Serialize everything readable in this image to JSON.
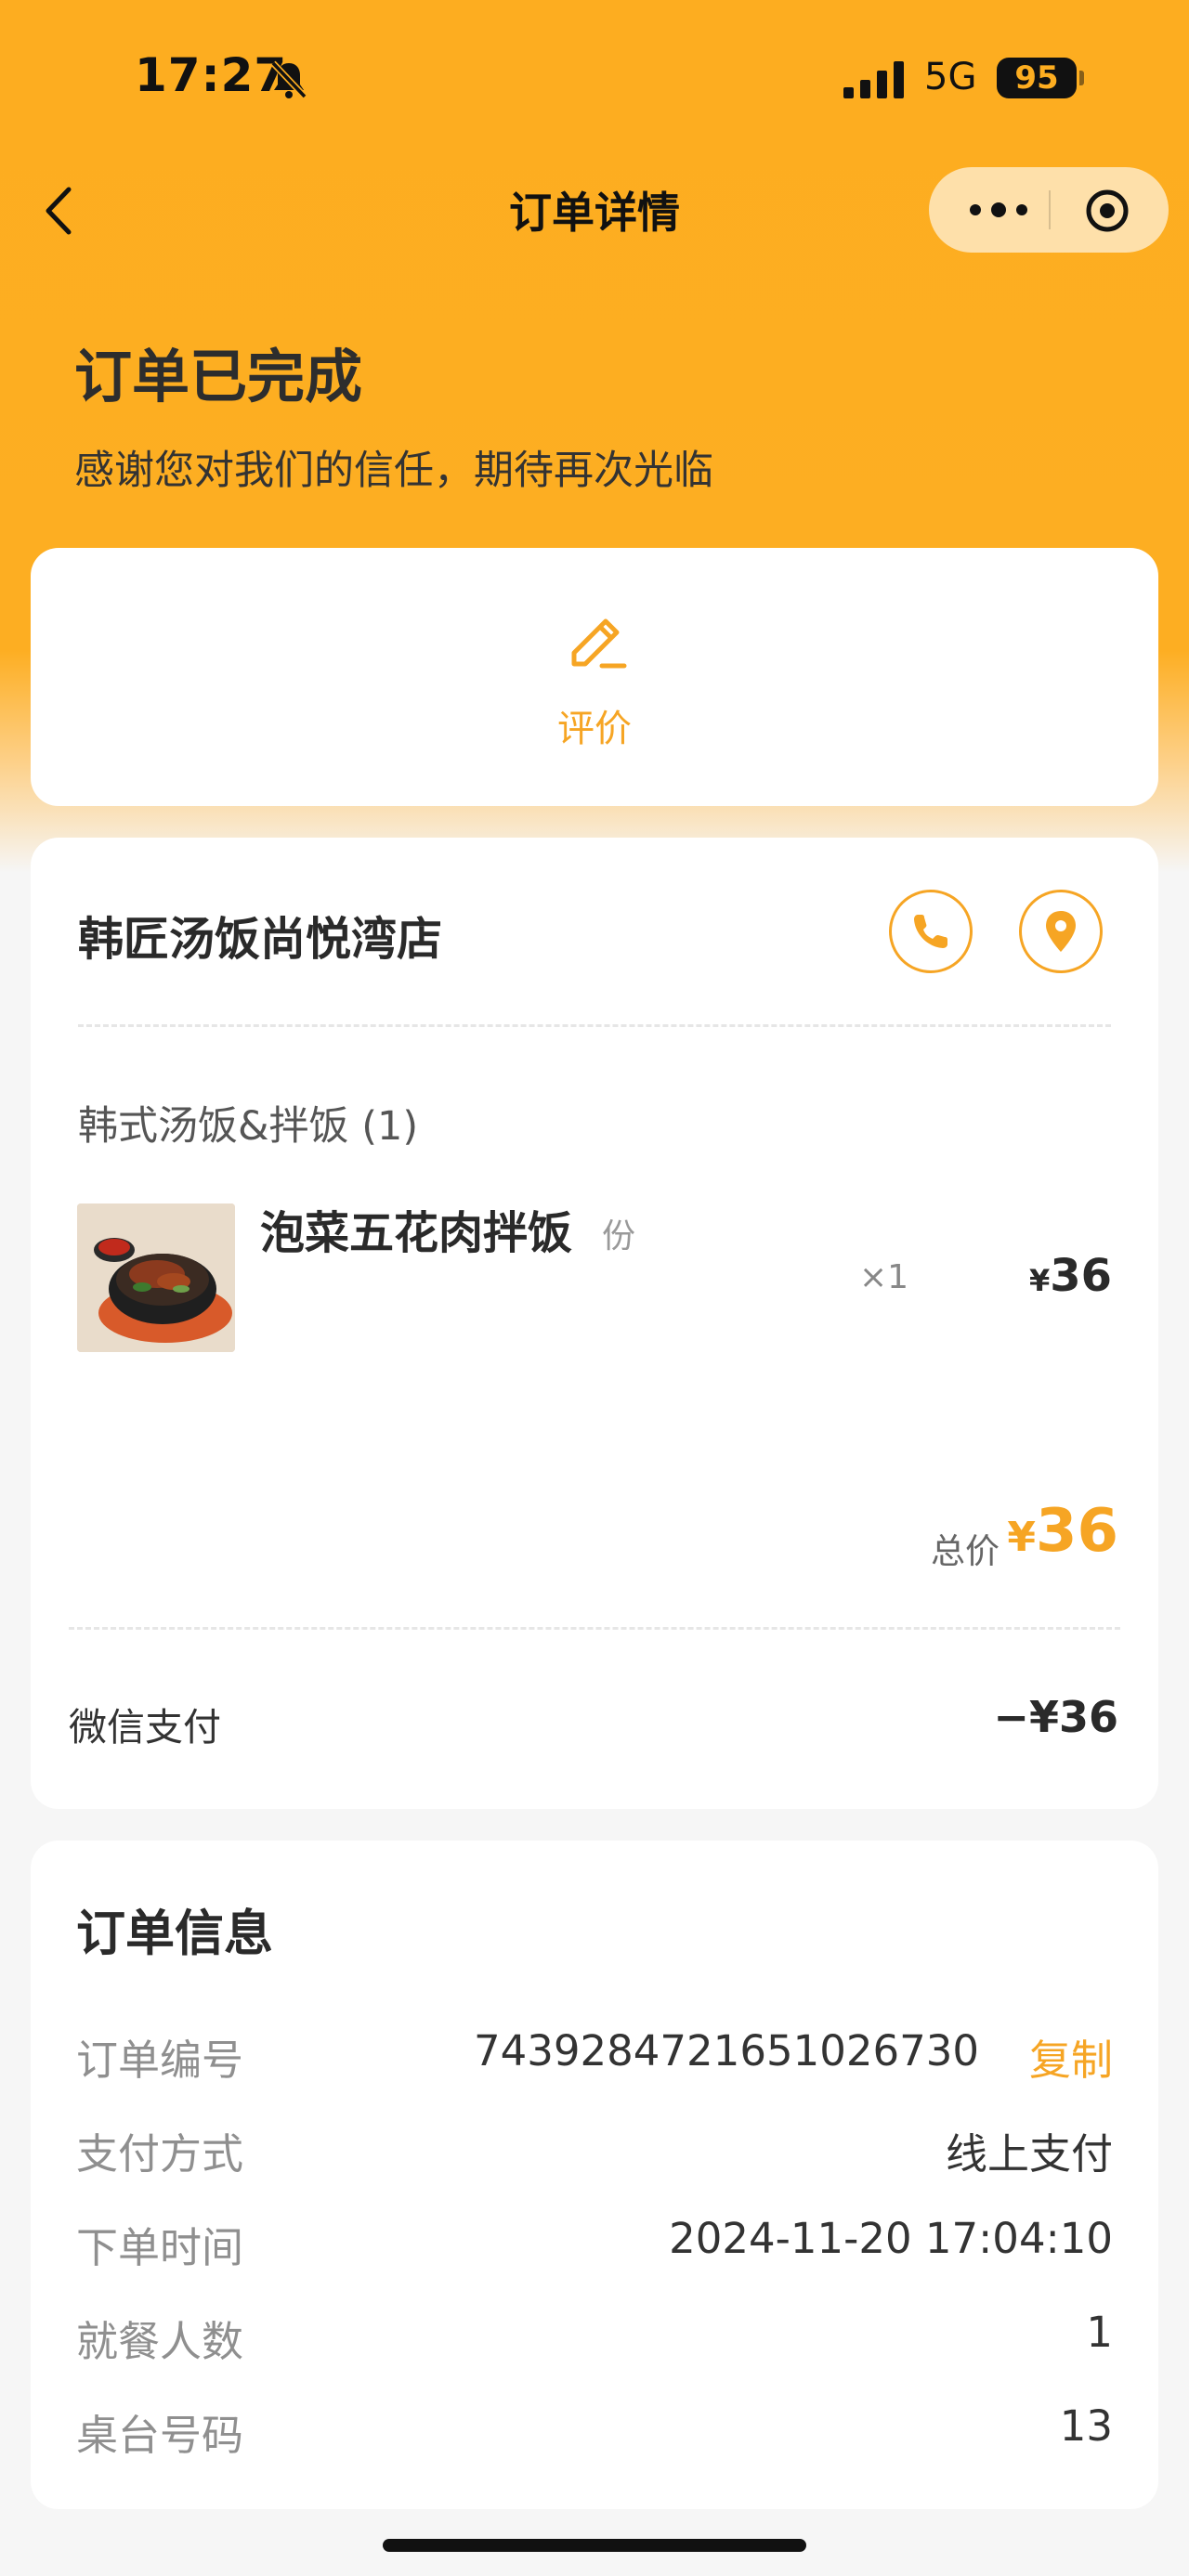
{
  "status_bar": {
    "time": "17:27",
    "network": "5G",
    "battery": "95"
  },
  "nav": {
    "title": "订单详情"
  },
  "header": {
    "heading": "订单已完成",
    "subtitle": "感谢您对我们的信任，期待再次光临"
  },
  "rate": {
    "label": "评价"
  },
  "order": {
    "store_name": "韩匠汤饭尚悦湾店",
    "category": "韩式汤饭&拌饭 (1)",
    "item": {
      "name": "泡菜五花肉拌饭",
      "unit": "份",
      "qty": "×1",
      "currency": "¥",
      "price": "36"
    },
    "total": {
      "label": "总价",
      "currency": "¥",
      "amount": "36"
    },
    "payment": {
      "method": "微信支付",
      "amount": "−¥36"
    }
  },
  "info": {
    "title": "订单信息",
    "order_no_label": "订单编号",
    "order_no": "7439284721651026730",
    "copy_label": "复制",
    "pay_type_label": "支付方式",
    "pay_type": "线上支付",
    "time_label": "下单时间",
    "time": "2024-11-20 17:04:10",
    "diners_label": "就餐人数",
    "diners": "1",
    "table_label": "桌台号码",
    "table": "13"
  },
  "colors": {
    "brand": "#FDAD20",
    "accent": "#F6A524",
    "background": "#F6F6F6"
  },
  "icons": [
    "bell-muted-icon",
    "signal-icon",
    "back-chevron-icon",
    "more-dots-icon",
    "close-target-icon",
    "edit-pen-icon",
    "phone-icon",
    "location-pin-icon"
  ]
}
